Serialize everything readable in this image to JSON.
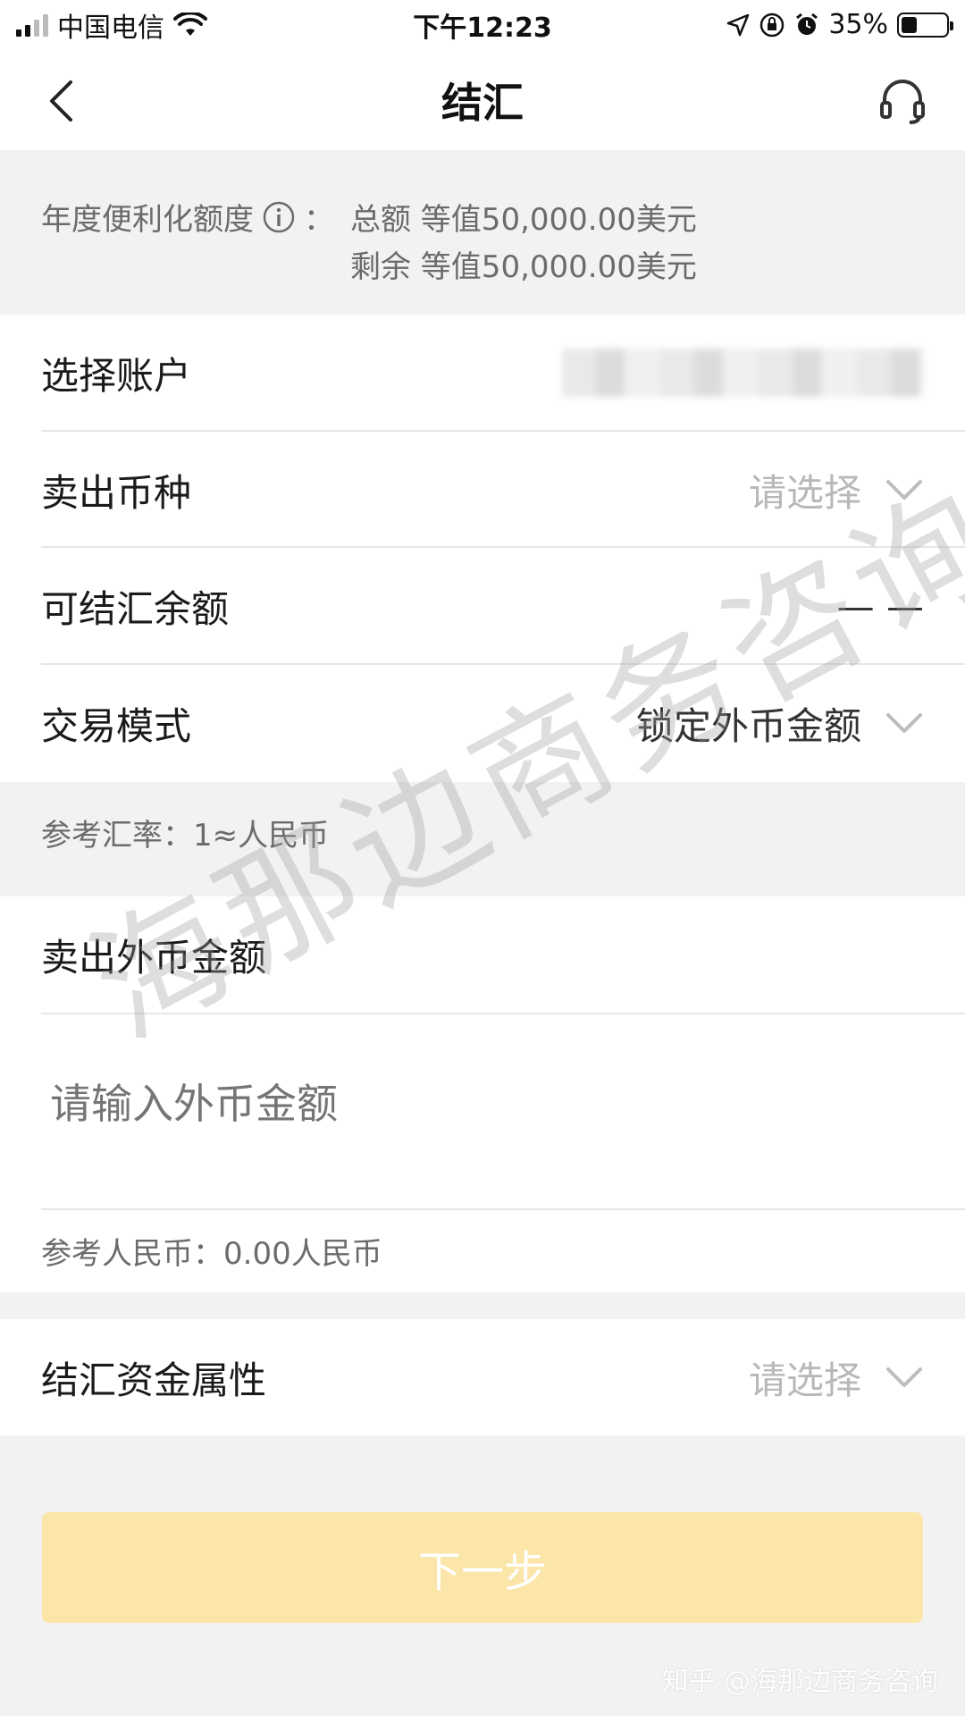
{
  "status_bar": {
    "carrier": "中国电信",
    "time": "下午12:23",
    "battery": "35%",
    "battery_level": 0.35
  },
  "nav": {
    "title": "结汇",
    "back_icon": "chevron-left-icon",
    "support_icon": "headset-icon"
  },
  "quota": {
    "label": "年度便利化额度",
    "info_icon": "info-circle-icon",
    "colon": "：",
    "total": "总额 等值50,000.00美元",
    "remaining": "剩余 等值50,000.00美元"
  },
  "form": {
    "account_label": "选择账户",
    "sell_currency_label": "卖出币种",
    "sell_currency_placeholder": "请选择",
    "balance_label": "可结汇余额",
    "balance_value": "— —",
    "mode_label": "交易模式",
    "mode_value": "锁定外币金额",
    "ref_rate": "参考汇率：1≈人民币",
    "sell_amount_label": "卖出外币金额",
    "amount_placeholder": "请输入外币金额",
    "ref_rmb": "参考人民币：0.00人民币",
    "fund_attr_label": "结汇资金属性",
    "fund_attr_placeholder": "请选择"
  },
  "next_button": "下一步",
  "watermark": "海那边商务咨询",
  "credit": "知乎 @海那边商务咨询"
}
